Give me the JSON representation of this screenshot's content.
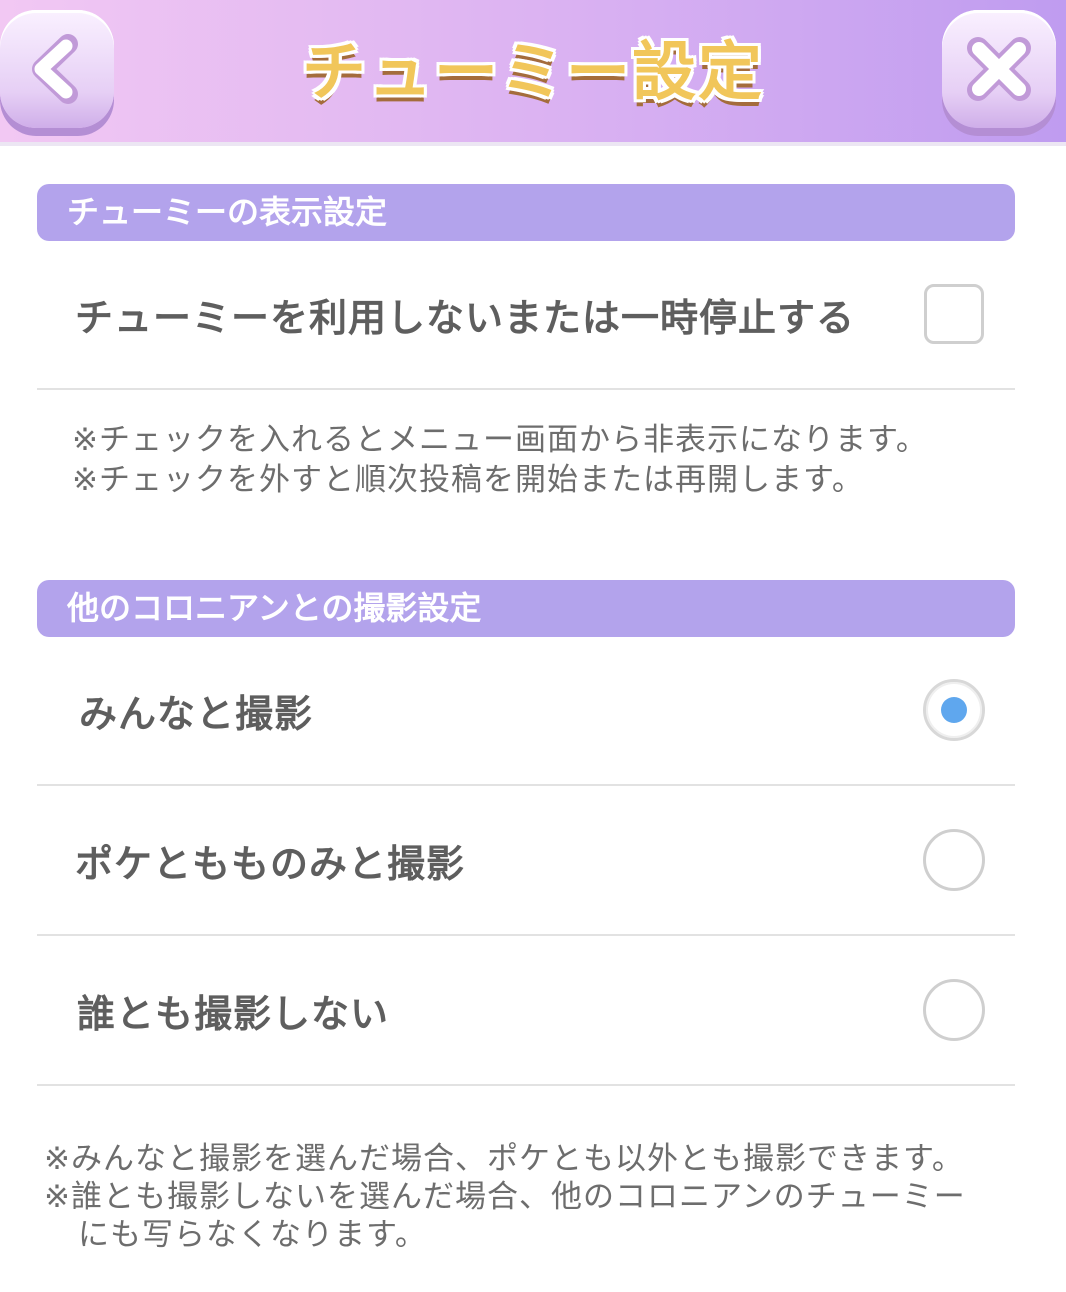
{
  "header": {
    "title": "チューミー設定",
    "back_icon": "chevron-left-icon",
    "close_icon": "close-icon"
  },
  "display_section": {
    "title": "チューミーの表示設定",
    "option_label": "チューミーを利用しないまたは一時停止する",
    "checked": false,
    "notes": [
      "※チェックを入れるとメニュー画面から非表示になります。",
      "※チェックを外すと順次投稿を開始または再開します。"
    ]
  },
  "photo_section": {
    "title": "他のコロニアンとの撮影設定",
    "options": [
      {
        "label": "みんなと撮影",
        "selected": true
      },
      {
        "label": "ポケともものみと撮影",
        "selected": false
      },
      {
        "label": "誰とも撮影しない",
        "selected": false
      }
    ],
    "notes": [
      "※みんなと撮影を選んだ場合、ポケとも以外とも撮影できます。",
      "※誰とも撮影しないを選んだ場合、他のコロニアンのチューミー",
      "にも写らなくなります。"
    ]
  },
  "colors": {
    "header_gradient_start": "#f2c8f3",
    "header_gradient_end": "#bf9cf0",
    "section_header": "#b3a3ec",
    "title_gold": "#f1c65a",
    "radio_selected": "#5fa7ee"
  }
}
